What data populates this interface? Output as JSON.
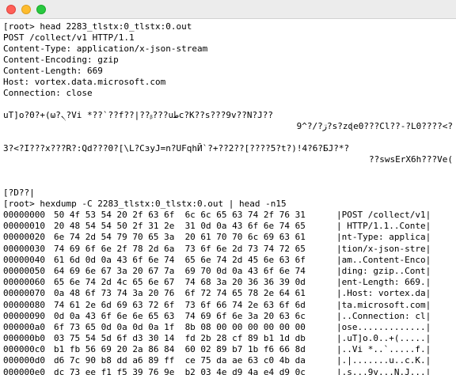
{
  "titlebar": {
    "buttons": [
      "close",
      "minimize",
      "zoom"
    ]
  },
  "terminal": {
    "head_section": {
      "prompt": "[root> head 2283_tlstx:0_tlstx:0.out",
      "http_lines": [
        "POST /collect/v1 HTTP/1.1",
        "Content-Type: application/x-json-stream",
        "Content-Encoding: gzip",
        "Content-Length: 669",
        "Host: vortex.data.microsoft.com",
        "Connection: close"
      ],
      "garbage_1": "uT]o?0?+(ω?৲?Vi *??`??f??|??ᵦ???uطc?K??s???9v??N?J??",
      "garbage_2": "9^?/?ڗ?s?zɖe0???Cl??-?L0????<?",
      "garbage_3": "3?<?I???x???R?:Qd???0?[\\L?CɜyJ=n?UFqhЙ`?+??2??[????5?t?)!4?6?БJ?*?",
      "garbage_4": "??swsErX6h???Ve(",
      "garbage_5": "[?D??|"
    },
    "hexdump_section": {
      "prompt": "[root> hexdump -C 2283_tlstx:0_tlstx:0.out | head -n15",
      "rows": [
        {
          "offset": "00000000",
          "bytes": "50 4f 53 54 20 2f 63 6f  6c 6c 65 63 74 2f 76 31",
          "ascii": "|POST /collect/v1|"
        },
        {
          "offset": "00000010",
          "bytes": "20 48 54 54 50 2f 31 2e  31 0d 0a 43 6f 6e 74 65",
          "ascii": "| HTTP/1.1..Conte|"
        },
        {
          "offset": "00000020",
          "bytes": "6e 74 2d 54 79 70 65 3a  20 61 70 70 6c 69 63 61",
          "ascii": "|nt-Type: applica|"
        },
        {
          "offset": "00000030",
          "bytes": "74 69 6f 6e 2f 78 2d 6a  73 6f 6e 2d 73 74 72 65",
          "ascii": "|tion/x-json-stre|"
        },
        {
          "offset": "00000040",
          "bytes": "61 6d 0d 0a 43 6f 6e 74  65 6e 74 2d 45 6e 63 6f",
          "ascii": "|am..Content-Enco|"
        },
        {
          "offset": "00000050",
          "bytes": "64 69 6e 67 3a 20 67 7a  69 70 0d 0a 43 6f 6e 74",
          "ascii": "|ding: gzip..Cont|"
        },
        {
          "offset": "00000060",
          "bytes": "65 6e 74 2d 4c 65 6e 67  74 68 3a 20 36 36 39 0d",
          "ascii": "|ent-Length: 669.|"
        },
        {
          "offset": "00000070",
          "bytes": "0a 48 6f 73 74 3a 20 76  6f 72 74 65 78 2e 64 61",
          "ascii": "|.Host: vortex.da|"
        },
        {
          "offset": "00000080",
          "bytes": "74 61 2e 6d 69 63 72 6f  73 6f 66 74 2e 63 6f 6d",
          "ascii": "|ta.microsoft.com|"
        },
        {
          "offset": "00000090",
          "bytes": "0d 0a 43 6f 6e 6e 65 63  74 69 6f 6e 3a 20 63 6c",
          "ascii": "|..Connection: cl|"
        },
        {
          "offset": "000000a0",
          "bytes": "6f 73 65 0d 0a 0d 0a 1f  8b 08 00 00 00 00 00 00",
          "ascii": "|ose.............|"
        },
        {
          "offset": "000000b0",
          "bytes": "03 75 54 5d 6f d3 30 14  fd 2b 28 cf 89 b1 1d db",
          "ascii": "|.uT]o.0..+(.....|"
        },
        {
          "offset": "000000c0",
          "bytes": "b1 fb 56 69 20 2a 86 84  60 02 89 b7 1b f6 66 8d",
          "ascii": "|..Vi *..`.....f.|"
        },
        {
          "offset": "000000d0",
          "bytes": "d6 7c 90 b8 dd a6 89 ff  ce 75 da ae 63 c0 4b da",
          "ascii": "|.|.......u..c.K.|"
        },
        {
          "offset": "000000e0",
          "bytes": "dc 73 ee f1 f5 39 76 9e  b2 03 4e d9 4a e4 d9 0c",
          "ascii": "|.s...9v...N.J...|"
        }
      ]
    }
  }
}
